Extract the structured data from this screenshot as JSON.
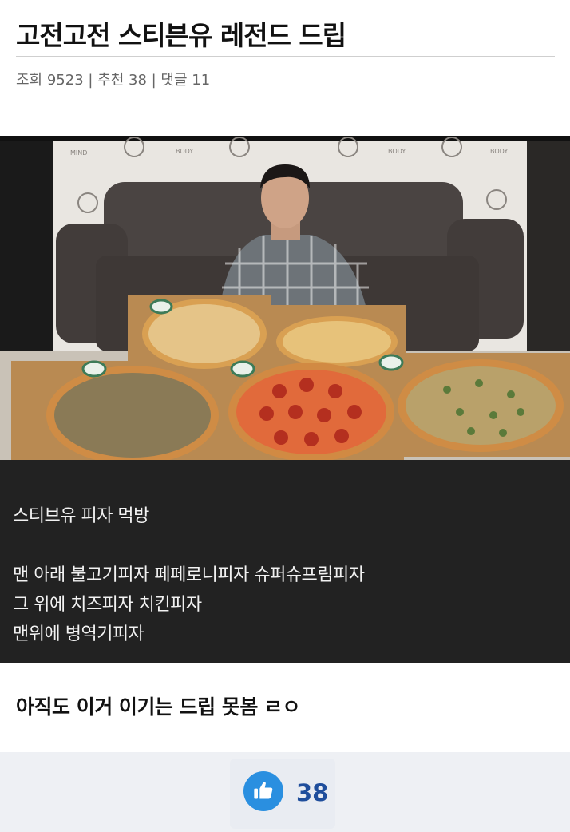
{
  "post": {
    "title": "고전고전 스티븐유 레전드 드립",
    "meta": "조회 9523 | 추천 38 | 댓글 11"
  },
  "image": {
    "alt": "스티브유 피자 먹방",
    "banner_texts": [
      "MIND",
      "BODY",
      "BODY",
      "BODY"
    ],
    "colors": {
      "backdrop": "#e9e6e1",
      "sofa": "#4a4442",
      "table": "#c9c2b7",
      "plaid": "#6d7378"
    }
  },
  "caption": {
    "lines": [
      "스티브유 피자 먹방",
      "맨 아래 불고기피자 페페로니피자 슈퍼슈프림피자",
      "그 위에 치즈피자 치킨피자",
      "맨위에 병역기피자"
    ]
  },
  "comment": "아직도 이거 이기는 드립 못봄 ㄹㅇ",
  "like": {
    "icon": "thumbs-up-icon",
    "count": "38",
    "accent": "#2a8fe0",
    "count_color": "#1f4e9c"
  }
}
